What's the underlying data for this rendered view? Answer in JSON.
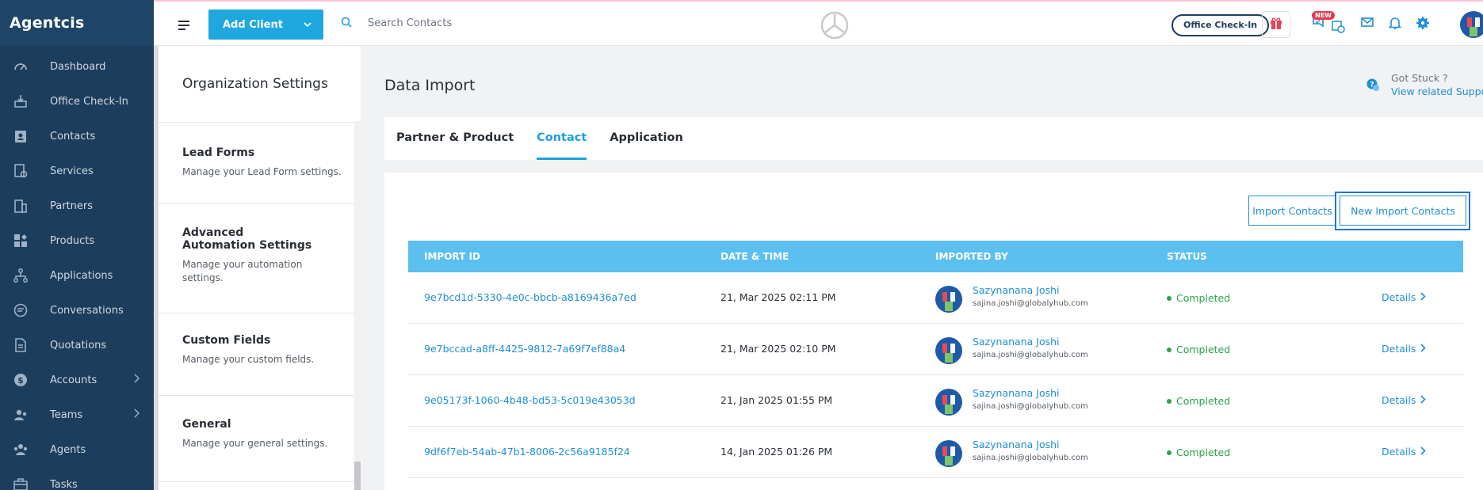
{
  "app": {
    "name": "Agentcis"
  },
  "nav": {
    "items": [
      {
        "label": "Dashboard",
        "icon": "gauge-icon"
      },
      {
        "label": "Office Check-In",
        "icon": "checkin-icon"
      },
      {
        "label": "Contacts",
        "icon": "contacts-icon"
      },
      {
        "label": "Services",
        "icon": "services-icon"
      },
      {
        "label": "Partners",
        "icon": "building-icon"
      },
      {
        "label": "Products",
        "icon": "products-icon"
      },
      {
        "label": "Applications",
        "icon": "applications-icon"
      },
      {
        "label": "Conversations",
        "icon": "chat-icon"
      },
      {
        "label": "Quotations",
        "icon": "document-icon"
      },
      {
        "label": "Accounts",
        "icon": "dollar-icon",
        "has_children": true
      },
      {
        "label": "Teams",
        "icon": "teams-icon",
        "has_children": true
      },
      {
        "label": "Agents",
        "icon": "agents-icon"
      },
      {
        "label": "Tasks",
        "icon": "briefcase-icon"
      }
    ]
  },
  "topbar": {
    "add_client_label": "Add Client",
    "search_placeholder": "Search Contacts",
    "office_checkin_label": "Office Check-In",
    "new_badge": "NEW"
  },
  "settings": {
    "title": "Organization Settings",
    "items": [
      {
        "title": "Lead Forms",
        "desc": "Manage your Lead Form settings."
      },
      {
        "title": "Advanced Automation Settings",
        "desc": "Manage your automation settings."
      },
      {
        "title": "Custom Fields",
        "desc": "Manage your custom fields."
      },
      {
        "title": "General",
        "desc": "Manage your general settings."
      }
    ]
  },
  "main": {
    "title": "Data Import",
    "help": {
      "question": "Got Stuck ?",
      "link": "View related Suppor"
    },
    "tabs": [
      {
        "label": "Partner & Product",
        "active": false
      },
      {
        "label": "Contact",
        "active": true
      },
      {
        "label": "Application",
        "active": false
      }
    ],
    "import_button": "Import Contacts",
    "new_import_button": "New Import Contacts",
    "table": {
      "headers": [
        "IMPORT ID",
        "DATE & TIME",
        "IMPORTED BY",
        "STATUS"
      ],
      "rows": [
        {
          "id": "9e7bcd1d-5330-4e0c-bbcb-a8169436a7ed",
          "datetime": "21, Mar 2025 02:11 PM",
          "user_name": "Sazynanana Joshi",
          "user_email": "sajina.joshi@globalyhub.com",
          "status": "Completed",
          "action": "Details"
        },
        {
          "id": "9e7bccad-a8ff-4425-9812-7a69f7ef88a4",
          "datetime": "21, Mar 2025 02:10 PM",
          "user_name": "Sazynanana Joshi",
          "user_email": "sajina.joshi@globalyhub.com",
          "status": "Completed",
          "action": "Details"
        },
        {
          "id": "9e05173f-1060-4b48-bd53-5c019e43053d",
          "datetime": "21, Jan 2025 01:55 PM",
          "user_name": "Sazynanana Joshi",
          "user_email": "sajina.joshi@globalyhub.com",
          "status": "Completed",
          "action": "Details"
        },
        {
          "id": "9df6f7eb-54ab-47b1-8006-2c56a9185f24",
          "datetime": "14, Jan 2025 01:26 PM",
          "user_name": "Sazynanana Joshi",
          "user_email": "sajina.joshi@globalyhub.com",
          "status": "Completed",
          "action": "Details"
        }
      ]
    }
  },
  "colors": {
    "sidebar": "#1c3d5c",
    "accent": "#1fa8e0",
    "table_header": "#5bbff0",
    "status_completed": "#2aa34a",
    "link": "#1f8fd6"
  }
}
